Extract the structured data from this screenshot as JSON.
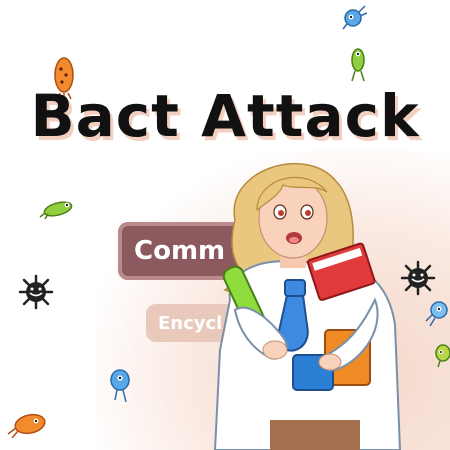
{
  "game": {
    "title": "Bact Attack"
  },
  "menu": {
    "primary_label": "Comm",
    "secondary_label": "Encycl"
  },
  "icons": {
    "germs": [
      "orange-germ-icon",
      "blue-germ-icon",
      "green-germ-icon",
      "black-virus-icon"
    ],
    "character": "scientist-character"
  },
  "colors": {
    "title_shadow": "#f3cfc0",
    "primary_button": "#8c5a5e",
    "secondary_button": "#e8c9bc",
    "coat": "#ffffff",
    "book": "#e03a3a"
  }
}
